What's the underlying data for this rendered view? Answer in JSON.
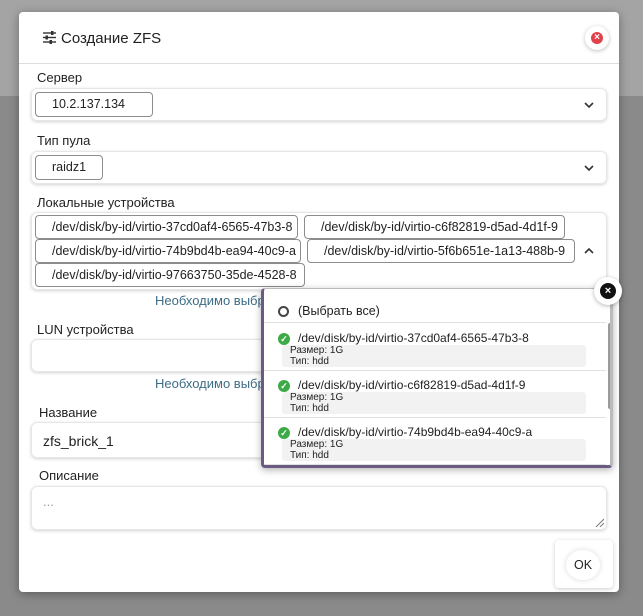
{
  "dialog": {
    "title": "Создание ZFS",
    "ok_label": "OK"
  },
  "server": {
    "label": "Сервер",
    "value": "10.2.137.134"
  },
  "pool_type": {
    "label": "Тип пула",
    "value": "raidz1"
  },
  "local_devices": {
    "label": "Локальные устройства",
    "selected": [
      "/dev/disk/by-id/virtio-37cd0af4-6565-47b3-8",
      "/dev/disk/by-id/virtio-c6f82819-d5ad-4d1f-9",
      "/dev/disk/by-id/virtio-74b9bd4b-ea94-40c9-a",
      "/dev/disk/by-id/virtio-5f6b651e-1a13-488b-9",
      "/dev/disk/by-id/virtio-97663750-35de-4528-8"
    ],
    "hint": "Необходимо выбр"
  },
  "lun_devices": {
    "label": "LUN устройства",
    "hint": "Необходимо выбр"
  },
  "name": {
    "label": "Название",
    "value": "zfs_brick_1"
  },
  "description": {
    "label": "Описание",
    "placeholder": "..."
  },
  "dropdown": {
    "select_all": "(Выбрать все)",
    "items": [
      {
        "path": "/dev/disk/by-id/virtio-37cd0af4-6565-47b3-8",
        "size": "Размер: 1G",
        "type": "Тип: hdd"
      },
      {
        "path": "/dev/disk/by-id/virtio-c6f82819-d5ad-4d1f-9",
        "size": "Размер: 1G",
        "type": "Тип: hdd"
      },
      {
        "path": "/dev/disk/by-id/virtio-74b9bd4b-ea94-40c9-a",
        "size": "Размер: 1G",
        "type": "Тип: hdd"
      }
    ]
  },
  "colors": {
    "check": "#3daa48",
    "hint": "#3d6d86",
    "close": "#e0414a"
  }
}
